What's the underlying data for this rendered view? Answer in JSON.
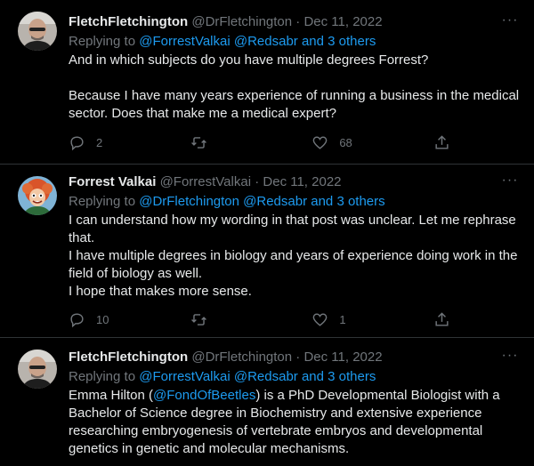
{
  "tweets": [
    {
      "name": "FletchFletchington",
      "handle": "@DrFletchington",
      "date": "Dec 11, 2022",
      "replying_prefix": "Replying to",
      "replying_to": "@ForrestValkai @Redsabr and 3 others",
      "text": [
        "And in which subjects do you have multiple degrees Forrest?",
        "",
        "Because I have many years experience of running a business in the medical sector. Does that make me a medical expert?"
      ],
      "replies": "2",
      "retweets": "",
      "likes": "68",
      "more": "···"
    },
    {
      "name": "Forrest Valkai",
      "handle": "@ForrestValkai",
      "date": "Dec 11, 2022",
      "replying_prefix": "Replying to",
      "replying_to": "@DrFletchington @Redsabr and 3 others",
      "text": [
        "I can understand how my wording in that post was unclear. Let me rephrase that.",
        "I have multiple degrees in biology and years of experience doing work in the field of biology as well.",
        "I hope that makes more sense."
      ],
      "replies": "10",
      "retweets": "",
      "likes": "1",
      "more": "···"
    },
    {
      "name": "FletchFletchington",
      "handle": "@DrFletchington",
      "date": "Dec 11, 2022",
      "replying_prefix": "Replying to",
      "replying_to": "@ForrestValkai @Redsabr and 3 others",
      "text_before": "Emma Hilton (",
      "text_mention": "@FondOfBeetles",
      "text_after": ") is a PhD Developmental Biologist with a Bachelor of Science degree in Biochemistry and extensive experience researching embryogenesis of vertebrate embryos and developmental genetics in genetic and molecular mechanisms.",
      "more": "···"
    }
  ],
  "dot": "·",
  "icons": [
    "avatar-bald-man",
    "avatar-cartoon-redhead",
    "reply-icon",
    "retweet-icon",
    "like-icon",
    "share-icon",
    "more-icon"
  ],
  "colors": {
    "background": "#000000",
    "text": "#e7e9ea",
    "muted": "#71767b",
    "link": "#1d9bf0",
    "divider": "#2f3336"
  }
}
